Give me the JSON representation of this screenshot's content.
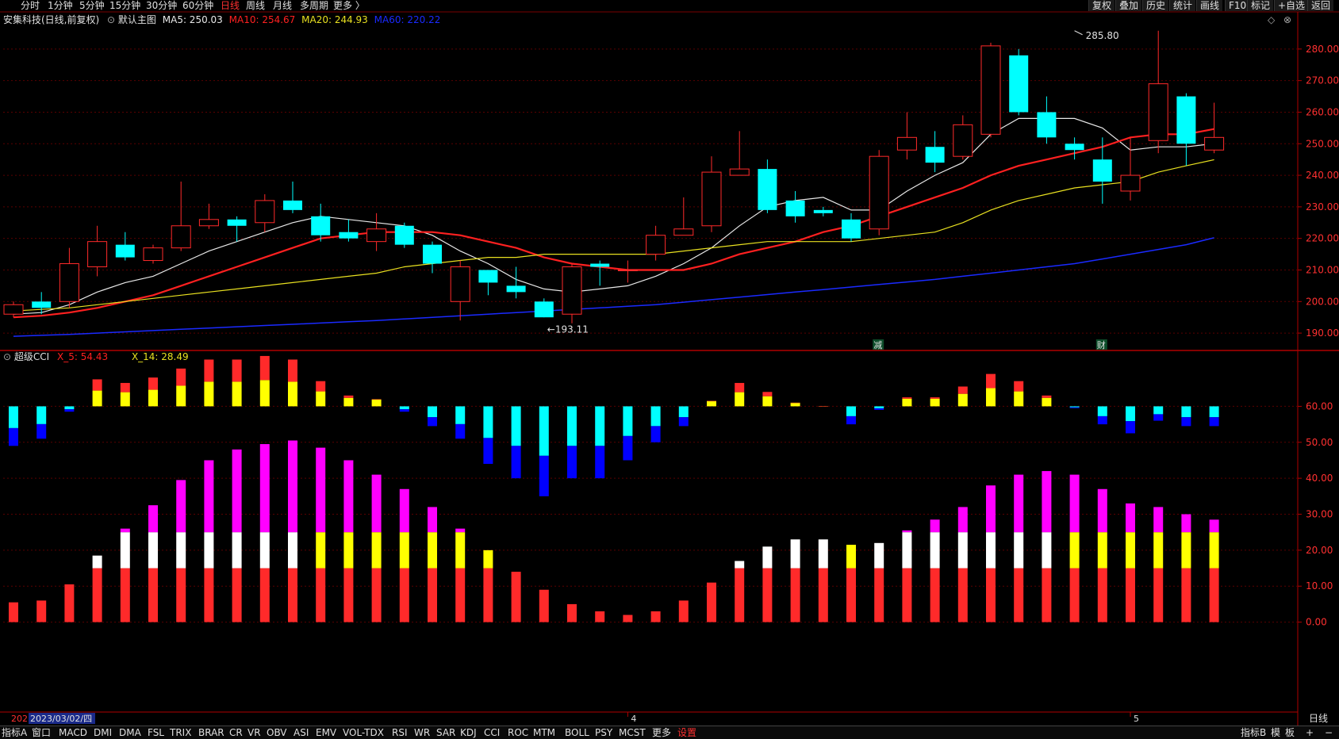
{
  "top_bar": {
    "periods": [
      "分时",
      "1分钟",
      "5分钟",
      "15分钟",
      "30分钟",
      "60分钟",
      "日线",
      "周线",
      "月线",
      "多周期",
      "更多 〉"
    ],
    "active_period": "日线",
    "tools": [
      "复权",
      "叠加",
      "历史",
      "统计",
      "画线",
      "F10",
      "标记",
      "+自选",
      "返回"
    ]
  },
  "main_legend": {
    "stock": "安集科技(日线,前复权)",
    "main_label": "默认主图",
    "ma5": "MA5: 250.03",
    "ma10": "MA10: 254.67",
    "ma20": "MA20: 244.93",
    "ma60": "MA60: 220.22"
  },
  "cci_legend": {
    "name": "超级CCI",
    "x5": "X_5: 54.43",
    "x14": "X_14: 28.49"
  },
  "colors": {
    "up": "#ff2a2a",
    "down": "#00ffff",
    "ma5": "#e8e8e8",
    "ma10": "#ff2020",
    "ma20": "#e8e020",
    "ma60": "#1a2aff",
    "magenta": "#ff00ff",
    "yellow": "#ffff00",
    "white": "#ffffff",
    "blue": "#0000ff",
    "grid": "#5a0000"
  },
  "chart_data": [
    {
      "type": "candlestick",
      "title": "安集科技(日线,前复权)",
      "ylim": [
        185,
        288
      ],
      "yticks": [
        190,
        200,
        210,
        220,
        230,
        240,
        250,
        260,
        270,
        280
      ],
      "annotations": [
        {
          "label": "285.80",
          "x_index": 38,
          "value": 285.8
        },
        {
          "label": "193.11",
          "x_index": 19,
          "value": 193.11
        },
        {
          "label": "减",
          "x_index": 31
        },
        {
          "label": "财",
          "x_index": 39
        }
      ],
      "date_labels": [
        {
          "label": "2023/03/02/四",
          "x_index": 0
        },
        {
          "label": "4",
          "x_index": 22
        },
        {
          "label": "5",
          "x_index": 40
        }
      ],
      "candles": [
        {
          "o": 196,
          "c": 199,
          "h": 200,
          "l": 195
        },
        {
          "o": 200,
          "c": 198,
          "h": 203,
          "l": 196
        },
        {
          "o": 200,
          "c": 212,
          "h": 217,
          "l": 198
        },
        {
          "o": 211,
          "c": 219,
          "h": 224,
          "l": 208
        },
        {
          "o": 218,
          "c": 214,
          "h": 222,
          "l": 213
        },
        {
          "o": 213,
          "c": 217,
          "h": 218,
          "l": 212
        },
        {
          "o": 217,
          "c": 224,
          "h": 238,
          "l": 216
        },
        {
          "o": 224,
          "c": 226,
          "h": 231,
          "l": 223
        },
        {
          "o": 226,
          "c": 224,
          "h": 227,
          "l": 219
        },
        {
          "o": 225,
          "c": 232,
          "h": 234,
          "l": 222
        },
        {
          "o": 232,
          "c": 229,
          "h": 238,
          "l": 228
        },
        {
          "o": 227,
          "c": 221,
          "h": 231,
          "l": 219
        },
        {
          "o": 222,
          "c": 220,
          "h": 226,
          "l": 219
        },
        {
          "o": 219,
          "c": 223,
          "h": 228,
          "l": 216
        },
        {
          "o": 224,
          "c": 218,
          "h": 225,
          "l": 217
        },
        {
          "o": 218,
          "c": 212,
          "h": 219,
          "l": 209
        },
        {
          "o": 200,
          "c": 211,
          "h": 213,
          "l": 194
        },
        {
          "o": 210,
          "c": 206,
          "h": 210,
          "l": 202
        },
        {
          "o": 205,
          "c": 203,
          "h": 211,
          "l": 201
        },
        {
          "o": 200,
          "c": 195,
          "h": 201,
          "l": 195
        },
        {
          "o": 196,
          "c": 211,
          "h": 212,
          "l": 193.11
        },
        {
          "o": 212,
          "c": 211,
          "h": 213,
          "l": 205
        },
        {
          "o": 210,
          "c": 210,
          "h": 213,
          "l": 206
        },
        {
          "o": 215,
          "c": 221,
          "h": 224,
          "l": 213
        },
        {
          "o": 221,
          "c": 223,
          "h": 233,
          "l": 221
        },
        {
          "o": 224,
          "c": 241,
          "h": 246,
          "l": 222
        },
        {
          "o": 240,
          "c": 242,
          "h": 254,
          "l": 240
        },
        {
          "o": 242,
          "c": 229,
          "h": 245,
          "l": 228
        },
        {
          "o": 232,
          "c": 227,
          "h": 235,
          "l": 225
        },
        {
          "o": 229,
          "c": 228,
          "h": 230,
          "l": 227
        },
        {
          "o": 226,
          "c": 220,
          "h": 228,
          "l": 219
        },
        {
          "o": 223,
          "c": 246,
          "h": 248,
          "l": 221
        },
        {
          "o": 248,
          "c": 252,
          "h": 260,
          "l": 245
        },
        {
          "o": 249,
          "c": 244,
          "h": 254,
          "l": 241
        },
        {
          "o": 246,
          "c": 256,
          "h": 259,
          "l": 245
        },
        {
          "o": 253,
          "c": 281,
          "h": 282,
          "l": 252
        },
        {
          "o": 278,
          "c": 260,
          "h": 280,
          "l": 259
        },
        {
          "o": 260,
          "c": 252,
          "h": 265,
          "l": 250
        },
        {
          "o": 250,
          "c": 248,
          "h": 252,
          "l": 245
        },
        {
          "o": 245,
          "c": 238,
          "h": 252,
          "l": 231
        },
        {
          "o": 235,
          "c": 240,
          "h": 252,
          "l": 232
        },
        {
          "o": 251,
          "c": 269,
          "h": 285.8,
          "l": 247
        },
        {
          "o": 265,
          "c": 250,
          "h": 266,
          "l": 243
        },
        {
          "o": 248,
          "c": 252,
          "h": 263,
          "l": 247
        }
      ],
      "series": [
        {
          "name": "MA5",
          "values": [
            196,
            196.5,
            199,
            203,
            206,
            208,
            212,
            216,
            219,
            222,
            225,
            227,
            226,
            225,
            224,
            221,
            216,
            212,
            207,
            204,
            203,
            204,
            205,
            208,
            212,
            217,
            224,
            230,
            232,
            233,
            229,
            229,
            235,
            240,
            244,
            253,
            258,
            258,
            258,
            255,
            248,
            249,
            249,
            250.03
          ]
        },
        {
          "name": "MA10",
          "values": [
            195,
            195.5,
            196.5,
            198,
            200,
            202,
            205,
            208,
            211,
            214,
            217,
            220,
            221,
            222,
            222,
            222,
            221,
            219,
            217,
            214,
            212,
            211,
            210,
            210,
            210,
            212,
            215,
            217,
            219,
            222,
            224,
            227,
            230,
            233,
            236,
            240,
            243,
            245,
            247,
            249,
            252,
            253,
            253,
            254.67
          ]
        },
        {
          "name": "MA20",
          "values": [
            197,
            197.5,
            198,
            199,
            200,
            201,
            202,
            203,
            204,
            205,
            206,
            207,
            208,
            209,
            211,
            212,
            213,
            214,
            214,
            215,
            215,
            215,
            215,
            215,
            216,
            217,
            218,
            219,
            219,
            219,
            219,
            220,
            221,
            222,
            225,
            229,
            232,
            234,
            236,
            237,
            238,
            241,
            243,
            244.93
          ]
        },
        {
          "name": "MA60",
          "values": [
            189,
            189.3,
            189.6,
            190,
            190.4,
            190.8,
            191.2,
            191.6,
            192,
            192.4,
            192.8,
            193.2,
            193.6,
            194,
            194.5,
            195,
            195.5,
            196,
            196.5,
            197,
            197.5,
            198,
            198.5,
            199,
            199.8,
            200.6,
            201.4,
            202.2,
            203,
            203.8,
            204.6,
            205.4,
            206.2,
            207,
            208,
            209,
            210,
            211,
            212,
            213.5,
            215,
            216.5,
            218,
            220.22
          ]
        }
      ]
    },
    {
      "type": "bar",
      "title": "超级CCI",
      "ylim": [
        -25,
        72
      ],
      "yticks": [
        0,
        10,
        20,
        30,
        40,
        50,
        60
      ],
      "series": [
        {
          "name": "X_14",
          "values": [
            5.5,
            6,
            10.5,
            18.5,
            26,
            32.5,
            39.5,
            45,
            48,
            49.5,
            50.5,
            48.5,
            45,
            41,
            37,
            32,
            26,
            20,
            14,
            9,
            5,
            3,
            2,
            3,
            6,
            11,
            17,
            21,
            23,
            23,
            21.5,
            22,
            25.5,
            28.5,
            32,
            38,
            41,
            42,
            41,
            37,
            33,
            32,
            30,
            28.49
          ]
        },
        {
          "name": "X_5",
          "values": [
            -11,
            -9,
            -1.5,
            7.5,
            6.5,
            8,
            10.5,
            13,
            13,
            14,
            13,
            7,
            3,
            2,
            -1.5,
            -5.5,
            -9,
            -16,
            -20,
            -25,
            -20,
            -20,
            -15,
            -10,
            -5.5,
            1.5,
            6.5,
            4,
            1,
            0,
            -5,
            -1,
            2.5,
            2.5,
            5.5,
            9,
            7,
            3,
            -0.5,
            -5,
            -7.5,
            -4,
            -5.5,
            -5.5
          ]
        }
      ]
    }
  ],
  "bottom_bar": {
    "items": [
      "指标A",
      "窗口",
      "MACD",
      "DMI",
      "DMA",
      "FSL",
      "TRIX",
      "BRAR",
      "CR",
      "VR",
      "OBV",
      "ASI",
      "EMV",
      "VOL-TDX",
      "RSI",
      "WR",
      "SAR",
      "KDJ",
      "CCI",
      "ROC",
      "MTM",
      "BOLL",
      "PSY",
      "MCST",
      "更多",
      "设置"
    ],
    "right": [
      "指标B",
      "模",
      "板",
      "+",
      "−"
    ]
  },
  "period_box": "日线"
}
